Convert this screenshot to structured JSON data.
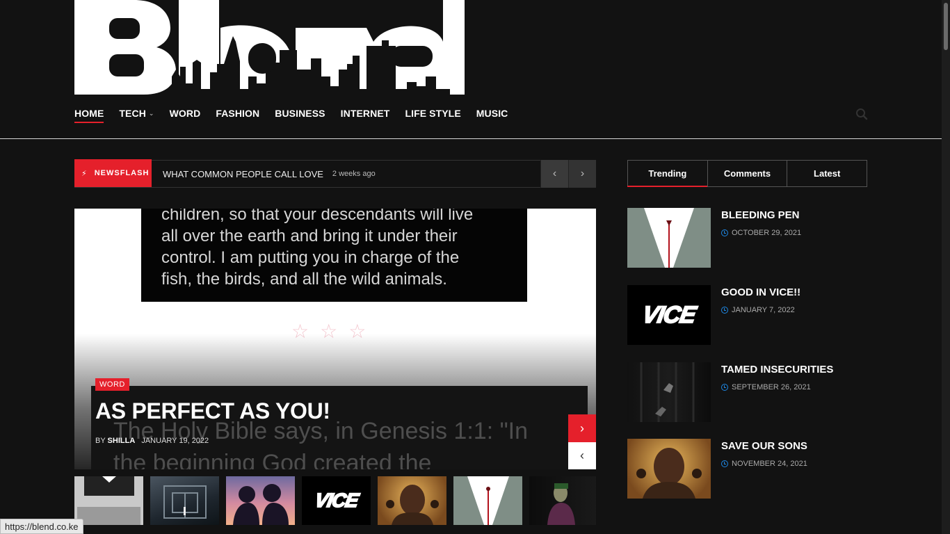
{
  "logo": {
    "text": "Blend"
  },
  "nav": {
    "items": [
      {
        "label": "HOME",
        "active": true
      },
      {
        "label": "TECH",
        "dropdown": true
      },
      {
        "label": "WORD"
      },
      {
        "label": "FASHION"
      },
      {
        "label": "BUSINESS"
      },
      {
        "label": "INTERNET"
      },
      {
        "label": "LIFE STYLE"
      },
      {
        "label": "MUSIC"
      }
    ],
    "search_icon": "search-icon"
  },
  "newsflash": {
    "label": "NEWSFLASH",
    "title": "WHAT COMMON PEOPLE CALL LOVE",
    "time": "2 weeks ago",
    "prev_icon": "chevron-left-icon",
    "next_icon": "chevron-right-icon"
  },
  "hero": {
    "image_lines": [
      "children, so that your descendants will live",
      "all over the earth and bring it under their",
      "control. I am putting you in charge of the",
      "fish, the birds, and all the wild animals."
    ],
    "bg_lines": [
      "The Holy Bible says, in Genesis 1:1: \"In",
      "the beginning God created the"
    ],
    "category": "WORD",
    "title": "AS PERFECT AS YOU!",
    "by": "BY",
    "author": "SHILLA",
    "date": "JANUARY 19, 2022"
  },
  "tabs": [
    {
      "label": "Trending",
      "active": true
    },
    {
      "label": "Comments"
    },
    {
      "label": "Latest"
    }
  ],
  "trending": [
    {
      "title": "BLEEDING PEN",
      "date": "OCTOBER 29, 2021",
      "image": "bleeding-pen"
    },
    {
      "title": "GOOD IN VICE!!",
      "date": "JANUARY 7, 2022",
      "image": "vice-logo"
    },
    {
      "title": "TAMED INSECURITIES",
      "date": "SEPTEMBER 26, 2021",
      "image": "hands-dark"
    },
    {
      "title": "SAVE OUR SONS",
      "date": "NOVEMBER 24, 2021",
      "image": "boy-portrait"
    }
  ],
  "vice_logo_text": "VICE",
  "statusbar": {
    "url": "https://blend.co.ke"
  },
  "colors": {
    "accent": "#e5202b",
    "background": "#121212",
    "date_icon": "#1e88e5"
  }
}
